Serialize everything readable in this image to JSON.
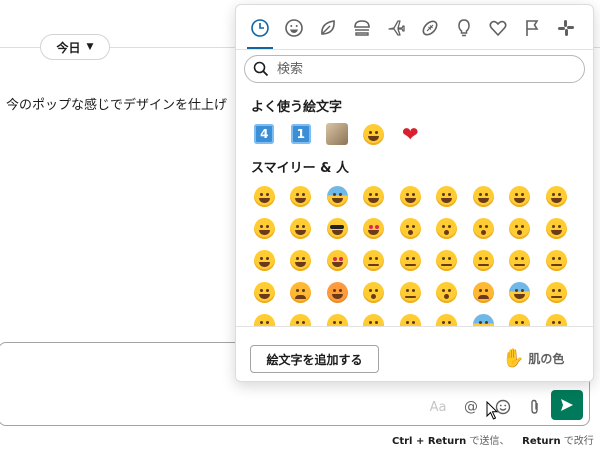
{
  "chat": {
    "day_label": "今日",
    "message_text": "今のポップな感じでデザインを仕上げ",
    "hint_key1": "Ctrl + Return",
    "hint_text1": "で送信、",
    "hint_key2": "Return",
    "hint_text2": "で改行",
    "composer_tools": {
      "format": "Aa",
      "mention": "@",
      "emoji_icon": "smile-icon",
      "attach_icon": "paperclip-icon",
      "send_icon": "send-icon"
    }
  },
  "picker": {
    "tabs": [
      {
        "icon": "clock-icon",
        "active": true
      },
      {
        "icon": "smile-icon"
      },
      {
        "icon": "leaf-icon"
      },
      {
        "icon": "burger-icon"
      },
      {
        "icon": "airplane-icon"
      },
      {
        "icon": "ball-icon"
      },
      {
        "icon": "lightbulb-icon"
      },
      {
        "icon": "heart-icon"
      },
      {
        "icon": "flag-icon"
      },
      {
        "icon": "slack-icon"
      }
    ],
    "search_placeholder": "検索",
    "frequent_title": "よく使う絵文字",
    "frequent": [
      "keycap-4",
      "keycap-1",
      "photo",
      "slightly-smiling-face",
      "heart"
    ],
    "frequent_keycap_values": [
      "4",
      "1"
    ],
    "smileys_title": "スマイリー & 人",
    "add_emoji_label": "絵文字を追加する",
    "skin_tone_label": "肌の色",
    "accent_color": "#1264a3",
    "send_color": "#007a5a"
  }
}
